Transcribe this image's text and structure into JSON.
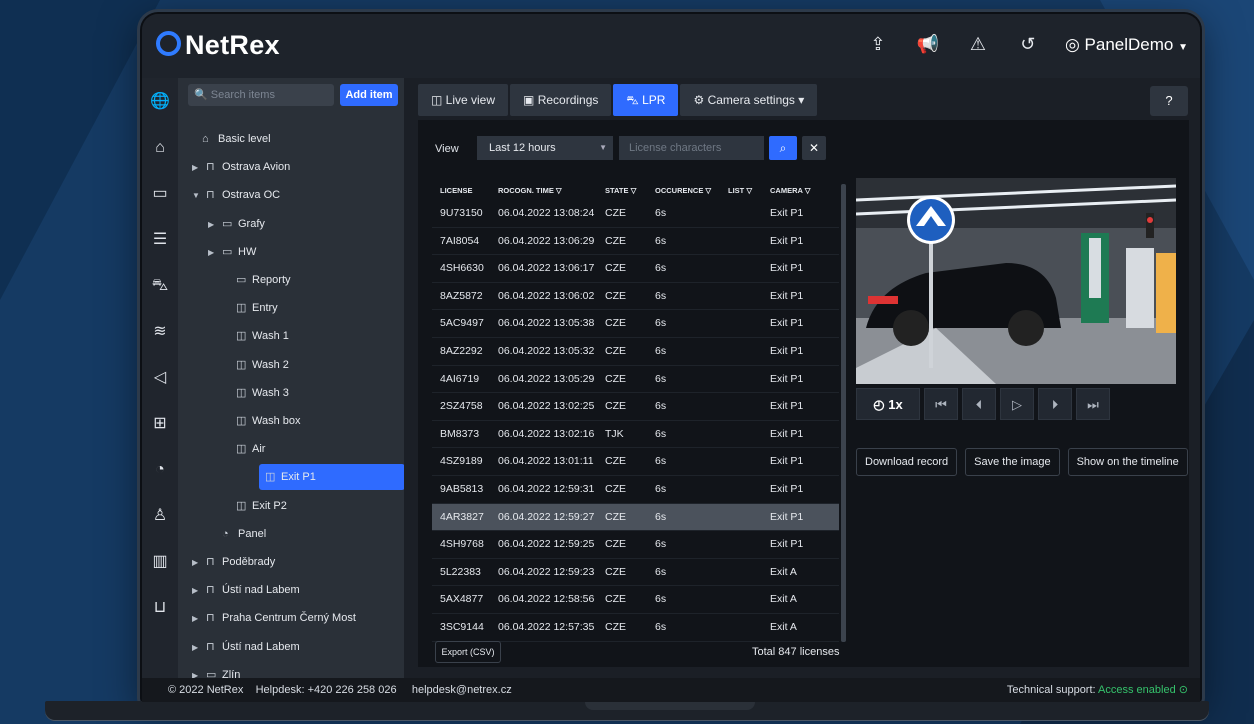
{
  "brand": {
    "name": "NetRex",
    "accent": "#2f6bff"
  },
  "header": {
    "user_label": "PanelDemo",
    "icons": [
      "export-icon",
      "megaphone-icon",
      "alert-triangle-icon",
      "history-icon",
      "user-circle-icon",
      "caret-down-icon"
    ]
  },
  "leftbar": {
    "icons": [
      "globe-icon",
      "building-icon",
      "camera-icon",
      "list-icon",
      "car-icon",
      "wifi-icon",
      "speaker-icon",
      "grid-icon",
      "chart-pie-icon",
      "user-icon",
      "bar-chart-icon",
      "basket-icon"
    ]
  },
  "sidebar": {
    "search_placeholder": "Search items",
    "add_label": "Add item",
    "items": [
      {
        "label": "Basic level",
        "icon": "home-icon",
        "indent": 0,
        "arrow": ""
      },
      {
        "label": "Ostrava Avion",
        "icon": "building-icon",
        "indent": 1,
        "arrow": "▶"
      },
      {
        "label": "Ostrava OC",
        "icon": "building-icon",
        "indent": 1,
        "arrow": "▼"
      },
      {
        "label": "Grafy",
        "icon": "folder-icon",
        "indent": 2,
        "arrow": "▶"
      },
      {
        "label": "HW",
        "icon": "folder-icon",
        "indent": 2,
        "arrow": "▶"
      },
      {
        "label": "Reporty",
        "icon": "folder-icon",
        "indent": 3,
        "arrow": ""
      },
      {
        "label": "Entry",
        "icon": "camera-icon",
        "indent": 3,
        "arrow": ""
      },
      {
        "label": "Wash 1",
        "icon": "camera-icon",
        "indent": 3,
        "arrow": ""
      },
      {
        "label": "Wash 2",
        "icon": "camera-icon",
        "indent": 3,
        "arrow": ""
      },
      {
        "label": "Wash 3",
        "icon": "camera-icon",
        "indent": 3,
        "arrow": ""
      },
      {
        "label": "Wash box",
        "icon": "camera-icon",
        "indent": 3,
        "arrow": ""
      },
      {
        "label": "Air",
        "icon": "camera-icon",
        "indent": 3,
        "arrow": ""
      },
      {
        "label": "Exit P1",
        "icon": "camera-icon",
        "indent": 3,
        "arrow": "",
        "selected": true
      },
      {
        "label": "Exit P2",
        "icon": "camera-icon",
        "indent": 3,
        "arrow": ""
      },
      {
        "label": "Panel",
        "icon": "chart-pie-icon",
        "indent": 2,
        "arrow": ""
      },
      {
        "label": "Poděbrady",
        "icon": "building-icon",
        "indent": 1,
        "arrow": "▶"
      },
      {
        "label": "Ústí nad Labem",
        "icon": "building-icon",
        "indent": 1,
        "arrow": "▶"
      },
      {
        "label": "Praha Centrum Černý Most",
        "icon": "building-icon",
        "indent": 1,
        "arrow": "▶"
      },
      {
        "label": "Ústí nad Labem",
        "icon": "building-icon",
        "indent": 1,
        "arrow": "▶"
      },
      {
        "label": "Zlín",
        "icon": "folder-icon",
        "indent": 1,
        "arrow": "▶"
      }
    ]
  },
  "tabs": [
    {
      "label": "Live view",
      "icon": "camera-icon"
    },
    {
      "label": "Recordings",
      "icon": "film-icon"
    },
    {
      "label": "LPR",
      "icon": "car-icon",
      "active": true
    },
    {
      "label": "Camera settings",
      "icon": "gear-icon",
      "caret": true
    }
  ],
  "filters": {
    "view_label": "View",
    "period": "Last 12 hours",
    "license_placeholder": "License characters"
  },
  "table": {
    "headers": [
      "LICENSE",
      "ROCOGN. TIME",
      "STATE",
      "OCCURENCE",
      "LIST",
      "CAMERA"
    ],
    "rows": [
      [
        "9U73150",
        "06.04.2022 13:08:24",
        "CZE",
        "6s",
        "Exit P1"
      ],
      [
        "7AI8054",
        "06.04.2022 13:06:29",
        "CZE",
        "6s",
        "Exit P1"
      ],
      [
        "4SH6630",
        "06.04.2022 13:06:17",
        "CZE",
        "6s",
        "Exit P1"
      ],
      [
        "8AZ5872",
        "06.04.2022 13:06:02",
        "CZE",
        "6s",
        "Exit P1"
      ],
      [
        "5AC9497",
        "06.04.2022 13:05:38",
        "CZE",
        "6s",
        "Exit P1"
      ],
      [
        "8AZ2292",
        "06.04.2022 13:05:32",
        "CZE",
        "6s",
        "Exit P1"
      ],
      [
        "4AI6719",
        "06.04.2022 13:05:29",
        "CZE",
        "6s",
        "Exit P1"
      ],
      [
        "2SZ4758",
        "06.04.2022 13:02:25",
        "CZE",
        "6s",
        "Exit P1"
      ],
      [
        "BM8373",
        "06.04.2022 13:02:16",
        "TJK",
        "6s",
        "Exit P1"
      ],
      [
        "4SZ9189",
        "06.04.2022 13:01:11",
        "CZE",
        "6s",
        "Exit P1"
      ],
      [
        "9AB5813",
        "06.04.2022 12:59:31",
        "CZE",
        "6s",
        "Exit P1"
      ],
      [
        "4AR3827",
        "06.04.2022 12:59:27",
        "CZE",
        "6s",
        "Exit P1"
      ],
      [
        "4SH9768",
        "06.04.2022 12:59:25",
        "CZE",
        "6s",
        "Exit P1"
      ],
      [
        "5L22383",
        "06.04.2022 12:59:23",
        "CZE",
        "6s",
        "Exit A"
      ],
      [
        "5AX4877",
        "06.04.2022 12:58:56",
        "CZE",
        "6s",
        "Exit A"
      ],
      [
        "3SC9144",
        "06.04.2022 12:57:35",
        "CZE",
        "6s",
        "Exit A"
      ]
    ],
    "highlight_row": 11,
    "export_label": "Export (CSV)",
    "total_label": "Total 847 licenses"
  },
  "player": {
    "speed": "1x",
    "buttons": [
      "Download record",
      "Save the image",
      "Show on the timeline"
    ]
  },
  "footer": {
    "copyright": "© 2022 NetRex",
    "helpdesk": "Helpdesk: +420 226 258 026",
    "email": "helpdesk@netrex.cz",
    "support_label": "Technical support:",
    "support_status": "Access enabled"
  }
}
